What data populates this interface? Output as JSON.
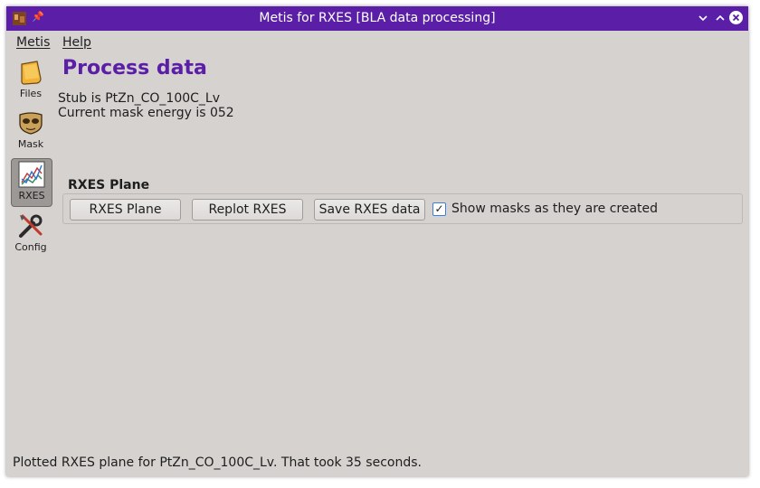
{
  "window": {
    "title": "Metis for RXES [BLA data processing]",
    "accent_color": "#5b1ea6",
    "controls": {
      "minimize_icon": "chevron-down-icon",
      "maximize_icon": "chevron-up-icon",
      "close_icon": "close-icon"
    }
  },
  "menubar": {
    "items": [
      {
        "label": "Metis"
      },
      {
        "label": "Help"
      }
    ]
  },
  "sidebar": {
    "items": [
      {
        "label": "Files",
        "icon": "folder-icon",
        "active": false
      },
      {
        "label": "Mask",
        "icon": "mask-icon",
        "active": false
      },
      {
        "label": "RXES",
        "icon": "plot-icon",
        "active": true
      },
      {
        "label": "Config",
        "icon": "tools-icon",
        "active": false
      }
    ]
  },
  "main": {
    "title": "Process data",
    "stub_line": "Stub is PtZn_CO_100C_Lv",
    "mask_line": "Current mask energy is 052",
    "group": {
      "title": "RXES Plane",
      "buttons": [
        {
          "label": "RXES Plane"
        },
        {
          "label": "Replot RXES"
        },
        {
          "label": "Save RXES data"
        }
      ],
      "checkbox": {
        "label": "Show masks as they are created",
        "checked": true
      }
    }
  },
  "status": {
    "text": "Plotted RXES plane for PtZn_CO_100C_Lv.  That took 35 seconds."
  }
}
